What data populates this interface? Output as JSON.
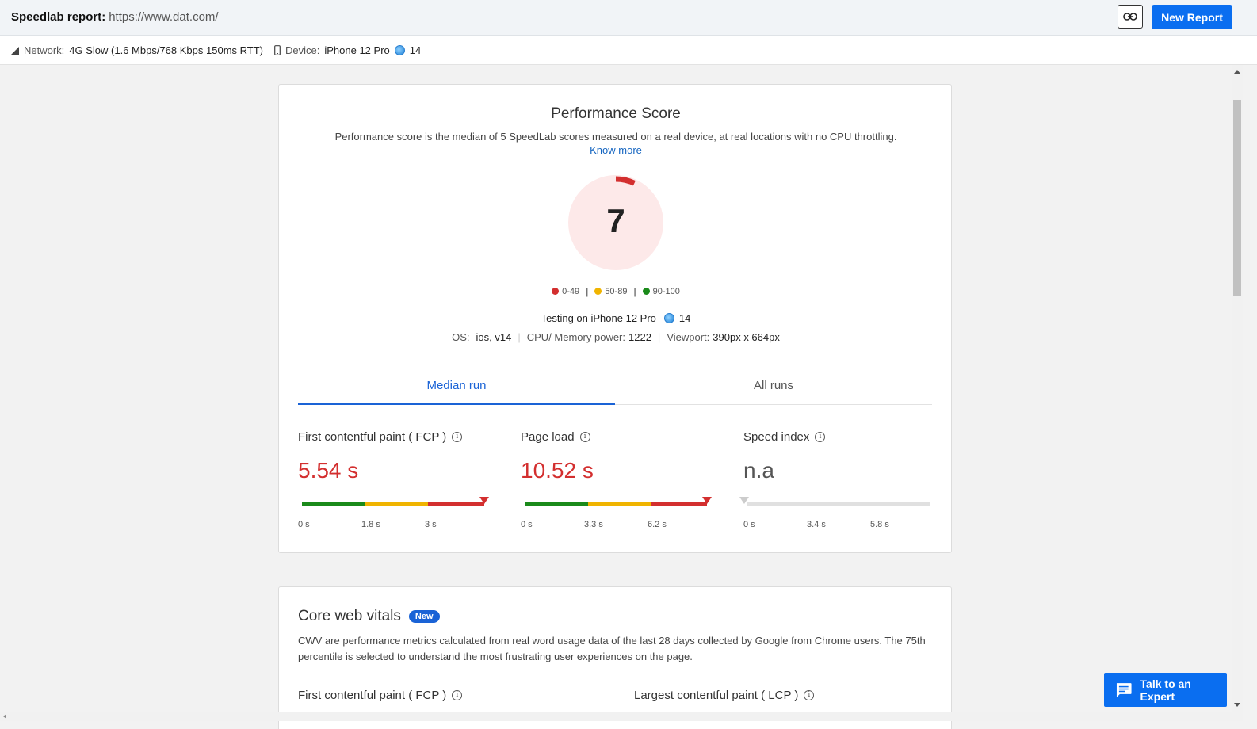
{
  "header": {
    "report_label": "Speedlab report:",
    "url": "https://www.dat.com/",
    "new_report": "New Report"
  },
  "infobar": {
    "network_label": "Network:",
    "network_value": "4G Slow (1.6 Mbps/768 Kbps 150ms RTT)",
    "device_label": "Device:",
    "device_value": "iPhone 12 Pro",
    "browser_version": "14"
  },
  "performance": {
    "title": "Performance Score",
    "description": "Performance score is the median of 5 SpeedLab scores measured on a real device, at real locations with no CPU throttling.",
    "know_more": "Know more",
    "score": "7",
    "score_value": 7,
    "legend": [
      {
        "label": "0-49",
        "color": "#d32f2f"
      },
      {
        "label": "50-89",
        "color": "#f0b400"
      },
      {
        "label": "90-100",
        "color": "#1a8a1a"
      }
    ],
    "testing_text": "Testing on iPhone 12 Pro",
    "testing_version": "14",
    "os_label": "OS:",
    "os_value": "ios, v14",
    "cpu_label": "CPU/ Memory power:",
    "cpu_value": "1222",
    "viewport_label": "Viewport:",
    "viewport_value": "390px x 664px"
  },
  "tabs": {
    "median": "Median run",
    "all": "All runs"
  },
  "metrics": [
    {
      "label": "First contentful paint ( FCP )",
      "value": "5.54 s",
      "ticks": [
        "0 s",
        "1.8 s",
        "3 s"
      ]
    },
    {
      "label": "Page load",
      "value": "10.52 s",
      "ticks": [
        "0 s",
        "3.3 s",
        "6.2 s"
      ]
    },
    {
      "label": "Speed index",
      "value": "n.a",
      "ticks": [
        "0 s",
        "3.4 s",
        "5.8 s"
      ]
    }
  ],
  "cwv": {
    "title": "Core web vitals",
    "badge": "New",
    "description": "CWV are performance metrics calculated from real word usage data of the last 28 days collected by Google from Chrome users. The 75th percentile is selected to understand the most frustrating user experiences on the page.",
    "metric_fcp": "First contentful paint ( FCP )",
    "metric_lcp": "Largest contentful paint ( LCP )"
  },
  "chat": {
    "label": "Talk to an Expert"
  },
  "colors": {
    "accent": "#0a6ef0",
    "poor": "#d32f2f",
    "average": "#f0b400",
    "good": "#1a8a1a"
  }
}
